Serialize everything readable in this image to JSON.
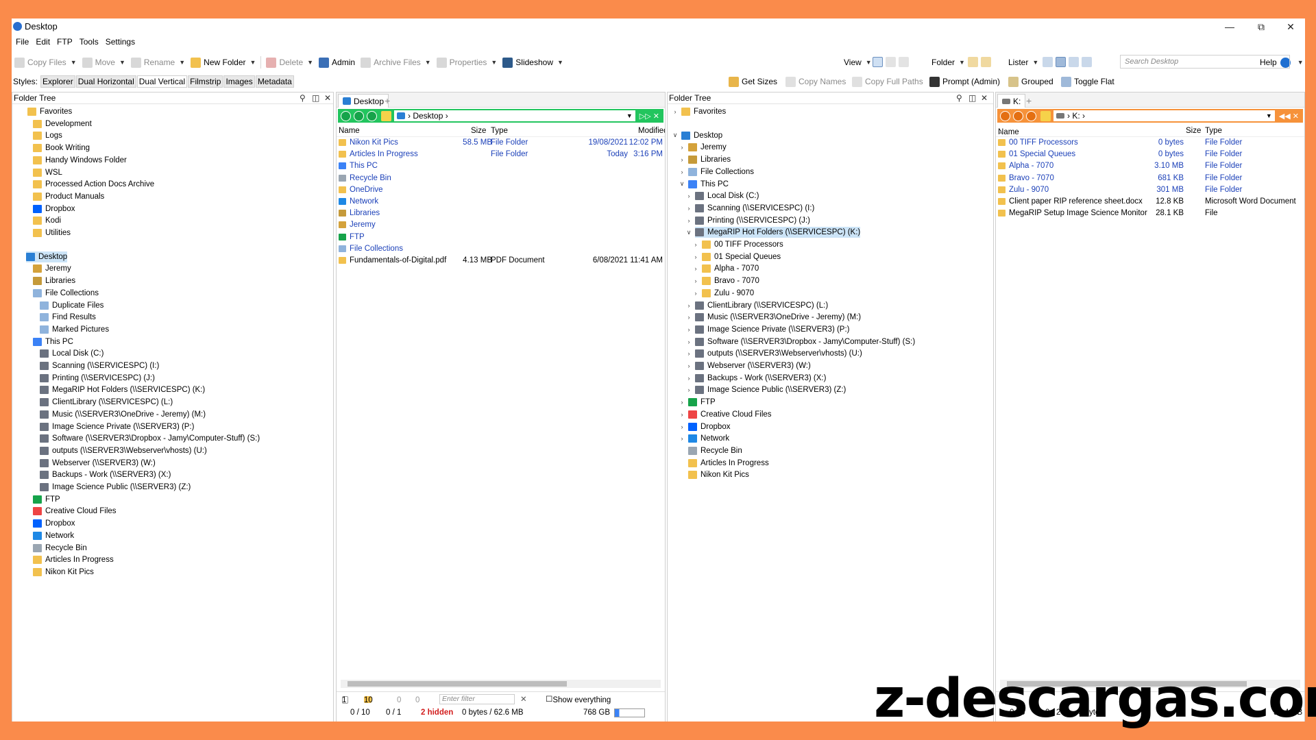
{
  "window": {
    "title": "Desktop"
  },
  "menu": [
    "File",
    "Edit",
    "FTP",
    "Tools",
    "Settings"
  ],
  "toolbar": {
    "copy_files": "Copy Files",
    "move": "Move",
    "rename": "Rename",
    "new_folder": "New Folder",
    "delete": "Delete",
    "admin": "Admin",
    "archive_files": "Archive Files",
    "properties": "Properties",
    "slideshow": "Slideshow",
    "view": "View",
    "folder": "Folder",
    "lister": "Lister",
    "help": "Help",
    "search_placeholder": "Search Desktop"
  },
  "styles": {
    "label": "Styles:",
    "items": [
      "Explorer",
      "Dual Horizontal",
      "Dual Vertical",
      "Filmstrip",
      "Images",
      "Metadata"
    ],
    "active": "Dual Vertical",
    "right_actions": [
      "Get Sizes",
      "Copy Names",
      "Copy Full Paths",
      "Prompt (Admin)",
      "Grouped",
      "Toggle Flat"
    ]
  },
  "left_tree": {
    "header": "Folder Tree",
    "items": [
      "Favorites",
      "Development",
      "Logs",
      "Book Writing",
      "Handy Windows Folder",
      "WSL",
      "Processed Action Docs Archive",
      "Product Manuals",
      "Dropbox",
      "Kodi",
      "Utilities",
      "Desktop",
      "Jeremy",
      "Libraries",
      "File Collections",
      "Duplicate Files",
      "Find Results",
      "Marked Pictures",
      "This PC",
      "Local Disk (C:)",
      "Scanning (\\\\SERVICESPC) (I:)",
      "Printing (\\\\SERVICESPC) (J:)",
      "MegaRIP Hot Folders (\\\\SERVICESPC) (K:)",
      "ClientLibrary (\\\\SERVICESPC) (L:)",
      "Music (\\\\SERVER3\\OneDrive - Jeremy) (M:)",
      "Image Science Private (\\\\SERVER3) (P:)",
      "Software (\\\\SERVER3\\Dropbox - Jamy\\Computer-Stuff) (S:)",
      "outputs (\\\\SERVER3\\Webserver\\vhosts) (U:)",
      "Webserver (\\\\SERVER3) (W:)",
      "Backups - Work (\\\\SERVER3) (X:)",
      "Image Science Public (\\\\SERVER3) (Z:)",
      "FTP",
      "Creative Cloud Files",
      "Dropbox",
      "Network",
      "Recycle Bin",
      "Articles In Progress",
      "Nikon Kit Pics"
    ]
  },
  "desktop_lister": {
    "tab": "Desktop",
    "path": "Desktop",
    "columns": [
      "Name",
      "Size",
      "Type",
      "Modified"
    ],
    "rows": [
      {
        "name": "Nikon Kit Pics",
        "size": "58.5 MB",
        "type": "File Folder",
        "date": "19/08/2021",
        "time": "12:02 PM"
      },
      {
        "name": "Articles In Progress",
        "size": "",
        "type": "File Folder",
        "date": "Today",
        "time": "3:16 PM"
      },
      {
        "name": "This PC",
        "size": "",
        "type": "",
        "date": "",
        "time": ""
      },
      {
        "name": "Recycle Bin",
        "size": "",
        "type": "",
        "date": "",
        "time": ""
      },
      {
        "name": "OneDrive",
        "size": "",
        "type": "",
        "date": "",
        "time": ""
      },
      {
        "name": "Network",
        "size": "",
        "type": "",
        "date": "",
        "time": ""
      },
      {
        "name": "Libraries",
        "size": "",
        "type": "",
        "date": "",
        "time": ""
      },
      {
        "name": "Jeremy",
        "size": "",
        "type": "",
        "date": "",
        "time": ""
      },
      {
        "name": "FTP",
        "size": "",
        "type": "",
        "date": "",
        "time": ""
      },
      {
        "name": "File Collections",
        "size": "",
        "type": "",
        "date": "",
        "time": ""
      },
      {
        "name": "Fundamentals-of-Digital.pdf",
        "size": "4.13 MB",
        "type": "PDF Document",
        "date": "6/08/2021",
        "time": "11:41 AM"
      }
    ],
    "status1": {
      "files": "1",
      "folders": "10",
      "c1": "0",
      "c2": "0",
      "filter_placeholder": "Enter filter",
      "show_everything": "Show everything"
    },
    "status2": {
      "folders_sel": "0 / 10",
      "files_sel": "0 / 1",
      "hidden": "2 hidden",
      "bytes": "0 bytes / 62.6 MB",
      "free": "768 GB"
    }
  },
  "right_tree": {
    "header": "Folder Tree",
    "items": [
      "Favorites",
      "Desktop",
      "Jeremy",
      "Libraries",
      "File Collections",
      "This PC",
      "Local Disk (C:)",
      "Scanning (\\\\SERVICESPC) (I:)",
      "Printing (\\\\SERVICESPC) (J:)",
      "MegaRIP Hot Folders (\\\\SERVICESPC) (K:)",
      "00 TIFF Processors",
      "01 Special Queues",
      "Alpha - 7070",
      "Bravo - 7070",
      "Zulu - 9070",
      "ClientLibrary (\\\\SERVICESPC) (L:)",
      "Music (\\\\SERVER3\\OneDrive - Jeremy) (M:)",
      "Image Science Private (\\\\SERVER3) (P:)",
      "Software (\\\\SERVER3\\Dropbox - Jamy\\Computer-Stuff) (S:)",
      "outputs (\\\\SERVER3\\Webserver\\vhosts) (U:)",
      "Webserver (\\\\SERVER3) (W:)",
      "Backups - Work (\\\\SERVER3) (X:)",
      "Image Science Public (\\\\SERVER3) (Z:)",
      "FTP",
      "Creative Cloud Files",
      "Dropbox",
      "Network",
      "Recycle Bin",
      "Articles In Progress",
      "Nikon Kit Pics"
    ]
  },
  "k_lister": {
    "tab": "K:",
    "path": "K:",
    "columns": [
      "Name",
      "Size",
      "Type"
    ],
    "rows": [
      {
        "name": "00 TIFF Processors",
        "size": "0 bytes",
        "type": "File Folder"
      },
      {
        "name": "01 Special Queues",
        "size": "0 bytes",
        "type": "File Folder"
      },
      {
        "name": "Alpha - 7070",
        "size": "3.10 MB",
        "type": "File Folder"
      },
      {
        "name": "Bravo - 7070",
        "size": "681 KB",
        "type": "File Folder"
      },
      {
        "name": "Zulu - 9070",
        "size": "301 MB",
        "type": "File Folder"
      },
      {
        "name": "Client paper RIP reference sheet.docx",
        "size": "12.8 KB",
        "type": "Microsoft Word Document"
      },
      {
        "name": "MegaRIP Setup Image Science Monitor",
        "size": "28.1 KB",
        "type": "File"
      }
    ],
    "status1": {
      "files": "5"
    },
    "status2": {
      "folders_sel": "0 / 5",
      "files_sel": "0 / 2",
      "bytes": "0 bytes",
      "free": "54.4 GB"
    }
  },
  "watermark": "z-descargas.com"
}
